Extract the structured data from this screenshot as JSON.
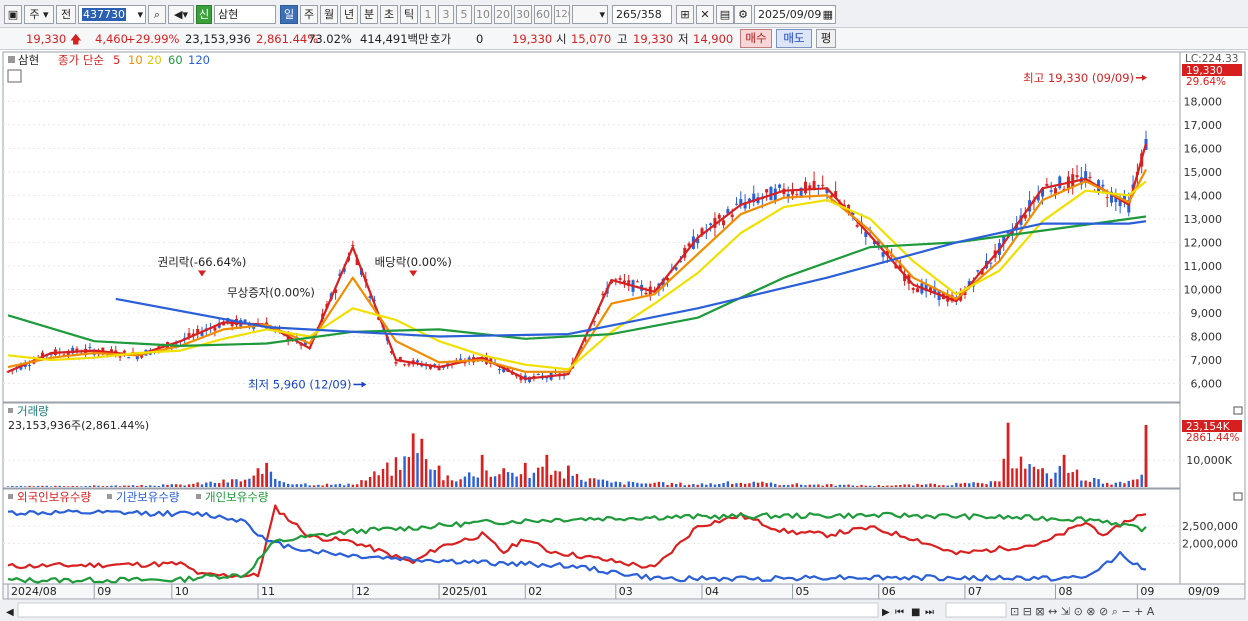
{
  "toolbar": {
    "market_type": "주",
    "scope": "전",
    "code": "437730",
    "flag": "신",
    "name": "삼현",
    "periods": [
      "일",
      "주",
      "월",
      "년",
      "분",
      "초",
      "틱"
    ],
    "active_period": "일",
    "intervals": [
      "1",
      "3",
      "5",
      "10",
      "20",
      "30",
      "60",
      "120"
    ],
    "count_current": "265",
    "count_total": "/358",
    "date": "2025/09/09"
  },
  "info": {
    "price": "19,330",
    "change": "4,460",
    "change_rate": "+29.99%",
    "volume": "23,153,936",
    "volume_rate": "2,861.44%",
    "turnover": "73.02%",
    "amount": "414,491백만",
    "quote_label": "호가",
    "quote_value": "0",
    "quote_price": "19,330",
    "open_label": "시",
    "open": "15,070",
    "high_label": "고",
    "high": "19,330",
    "low_label": "저",
    "low": "14,900",
    "buy_label": "매수",
    "sell_label": "매도",
    "avg_label": "평"
  },
  "legend": {
    "name": "삼현",
    "close_label": "종가 단순",
    "ma_periods": [
      "5",
      "10",
      "20",
      "60",
      "120"
    ],
    "ma_colors": [
      "#d92020",
      "#f08c00",
      "#f0e000",
      "#1e9a3a",
      "#2a5fd8"
    ]
  },
  "annotations": {
    "rights": "권리락(-66.64%)",
    "bonus": "무상증자(0.00%)",
    "dividend": "배당락(0.00%)",
    "low": "최저 5,960 (12/09)",
    "high": "최고 19,330 (09/09)"
  },
  "right_labels": {
    "lc": "LC:224.33",
    "price": "19,330",
    "pct": "29.64%",
    "vol": "23,154K",
    "vol_pct": "2861.44%"
  },
  "volume_panel": {
    "title": "거래량",
    "summary": "23,153,936주(2,861.44%)"
  },
  "holding_panel": {
    "series_names": [
      "외국인보유수량",
      "기관보유수량",
      "개인보유수량"
    ],
    "colors": [
      "#d92020",
      "#2a5fd8",
      "#1e9a3a"
    ]
  },
  "date_axis": {
    "labels": [
      "2024/08",
      "09",
      "10",
      "11",
      "12",
      "2025/01",
      "02",
      "03",
      "04",
      "05",
      "06",
      "07",
      "08",
      "09"
    ],
    "right_label": "09/09"
  },
  "chart_data": [
    {
      "type": "line",
      "ylim": [
        5300,
        19500
      ],
      "y_ticks": [
        6000,
        7000,
        8000,
        9000,
        10000,
        11000,
        12000,
        13000,
        14000,
        15000,
        16000,
        17000,
        18000
      ],
      "series": [
        {
          "name": "5",
          "x": [
            0,
            10,
            20,
            30,
            40,
            50,
            60,
            70,
            80,
            90,
            100,
            110,
            120,
            130,
            140,
            150,
            160,
            170,
            180,
            190,
            200,
            210,
            220,
            230,
            240,
            250,
            260,
            264
          ],
          "values": [
            6500,
            7300,
            7400,
            7200,
            7800,
            8600,
            8500,
            7500,
            11800,
            7000,
            6700,
            7100,
            6200,
            6400,
            10400,
            9900,
            12200,
            13600,
            14200,
            14300,
            12300,
            10200,
            9500,
            11700,
            14300,
            14700,
            13600,
            16200
          ]
        },
        {
          "name": "10",
          "x": [
            0,
            10,
            20,
            30,
            40,
            50,
            60,
            70,
            80,
            90,
            100,
            110,
            120,
            130,
            140,
            150,
            160,
            170,
            180,
            190,
            200,
            210,
            220,
            230,
            240,
            250,
            260,
            264
          ],
          "values": [
            6700,
            7100,
            7300,
            7200,
            7600,
            8300,
            8500,
            7700,
            10500,
            7800,
            6900,
            7000,
            6500,
            6500,
            9400,
            9800,
            11500,
            13200,
            13900,
            14000,
            12500,
            10500,
            9600,
            11200,
            13800,
            14600,
            13700,
            15100
          ]
        },
        {
          "name": "20",
          "x": [
            0,
            10,
            20,
            30,
            40,
            50,
            60,
            70,
            80,
            90,
            100,
            110,
            120,
            130,
            140,
            150,
            160,
            170,
            180,
            190,
            200,
            210,
            220,
            230,
            240,
            250,
            260,
            264
          ],
          "values": [
            7200,
            7000,
            7100,
            7300,
            7400,
            7900,
            8300,
            8000,
            9200,
            8700,
            7800,
            7200,
            6800,
            6600,
            8200,
            9400,
            10700,
            12400,
            13500,
            13800,
            13000,
            11200,
            9800,
            10800,
            12900,
            14200,
            14000,
            14600
          ]
        },
        {
          "name": "60",
          "x": [
            0,
            20,
            40,
            60,
            80,
            100,
            120,
            140,
            160,
            180,
            200,
            220,
            240,
            260,
            264
          ],
          "values": [
            8900,
            7800,
            7600,
            7700,
            8200,
            8300,
            7900,
            8100,
            8800,
            10500,
            11800,
            12000,
            12500,
            13000,
            13100
          ]
        },
        {
          "name": "120",
          "x": [
            25,
            60,
            100,
            130,
            160,
            190,
            220,
            240,
            260,
            264
          ],
          "values": [
            9600,
            8400,
            8000,
            8100,
            9200,
            10500,
            12000,
            12800,
            12800,
            12900
          ]
        }
      ],
      "annotations_x": {
        "rights": 45,
        "bonus": 61,
        "dividend": 94,
        "low": 82,
        "high": 264
      }
    },
    {
      "type": "bar",
      "title": "거래량",
      "ylim": [
        0,
        25000
      ],
      "y_ticks": [
        10000
      ],
      "x": [
        0,
        10,
        20,
        30,
        40,
        45,
        55,
        58,
        60,
        62,
        65,
        70,
        80,
        94,
        96,
        100,
        105,
        110,
        115,
        120,
        125,
        130,
        140,
        150,
        160,
        170,
        180,
        190,
        200,
        210,
        220,
        230,
        232,
        240,
        245,
        255,
        260,
        262,
        264
      ],
      "values": [
        500,
        600,
        800,
        900,
        1500,
        2500,
        5000,
        7000,
        9000,
        6000,
        3000,
        2000,
        1500,
        20000,
        18000,
        8000,
        6000,
        12000,
        7000,
        9000,
        12000,
        8000,
        3000,
        2500,
        2000,
        3000,
        2000,
        1500,
        1000,
        1500,
        2000,
        3000,
        24000,
        7000,
        12000,
        2000,
        3000,
        4000,
        23154
      ]
    },
    {
      "type": "line",
      "y_ticks": [
        2000000,
        2500000
      ],
      "series": [
        {
          "name": "외국인보유수량",
          "x": [
            0,
            40,
            45,
            58,
            62,
            70,
            80,
            94,
            100,
            110,
            115,
            120,
            125,
            140,
            150,
            160,
            170,
            180,
            190,
            200,
            210,
            220,
            230,
            240,
            250,
            255,
            258,
            262,
            264
          ],
          "values": [
            1350000,
            1420000,
            1100000,
            1080000,
            3020000,
            2200000,
            2050000,
            1450000,
            1900000,
            2250000,
            1750000,
            2150000,
            1800000,
            1500000,
            1300000,
            2500000,
            2800000,
            2350000,
            2250000,
            2450000,
            2150000,
            1700000,
            1850000,
            2000000,
            2600000,
            2200000,
            2550000,
            2780000,
            2800000
          ]
        },
        {
          "name": "기관보유수량",
          "x": [
            0,
            30,
            45,
            55,
            60,
            70,
            80,
            94,
            110,
            130,
            150,
            170,
            190,
            210,
            230,
            240,
            250,
            255,
            258,
            262,
            264
          ],
          "values": [
            2880000,
            2870000,
            2840000,
            2650000,
            2050000,
            1800000,
            1650000,
            1550000,
            1450000,
            1370000,
            1000000,
            990000,
            1040000,
            1020000,
            1010000,
            1010000,
            1010000,
            1450000,
            1710000,
            1400000,
            1200000
          ]
        },
        {
          "name": "개인보유수량",
          "x": [
            0,
            40,
            45,
            55,
            60,
            62,
            70,
            80,
            94,
            110,
            130,
            150,
            170,
            190,
            210,
            230,
            250,
            255,
            258,
            262,
            264
          ],
          "values": [
            950000,
            960000,
            1050000,
            1100000,
            1800000,
            2050000,
            2200000,
            2350000,
            2450000,
            2600000,
            2700000,
            2750000,
            2780000,
            2800000,
            2800000,
            2750000,
            2700000,
            2650000,
            2500000,
            2450000,
            2400000
          ]
        }
      ]
    }
  ]
}
